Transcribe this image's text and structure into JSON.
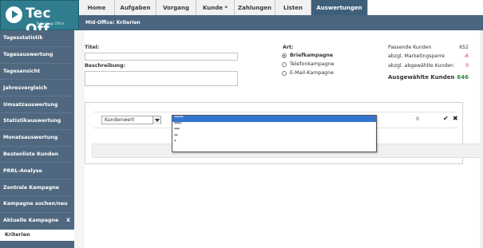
{
  "brand": {
    "name": "Tec Off",
    "tagline": "Technology Office"
  },
  "nav": {
    "tabs": [
      "Home",
      "Aufgaben",
      "Vorgang",
      "Kunde *",
      "Zahlungen",
      "Listen",
      "Auswertungen"
    ],
    "active": "Auswertungen"
  },
  "breadcrumb": "Mid-Office: Kriterien",
  "sidebar": {
    "items": [
      "Tagesstatistik",
      "Tagesauswertung",
      "Tagesansicht",
      "Jahresvergleich",
      "Umsatzauswertung",
      "Statistikauswertung",
      "Monatsauswertung",
      "Bestenliste Kunden",
      "PRRL-Analyse",
      "Zentrale Kampagne",
      "Kampagne suchen/neu"
    ],
    "current": {
      "label": "Aktuelle Kampagne",
      "close": "X"
    },
    "sub": "Kriterien"
  },
  "form": {
    "title_label": "Titel:",
    "title_value": "",
    "description_label": "Beschreibung:",
    "description_value": ""
  },
  "art": {
    "label": "Art:",
    "options": [
      "Briefkampagne",
      "Telefonkampagne",
      "E-Mail-Kampagne"
    ],
    "selected": "Briefkampagne"
  },
  "stats": {
    "rows": [
      {
        "label": "Passende Kunden",
        "value": "652"
      },
      {
        "label": "abzgl. Marketingsperre",
        "value": "-6"
      },
      {
        "label": "abzgl. abgewählte Kunden",
        "value": "0"
      },
      {
        "label": "Ausgewählte Kunden",
        "value": "646"
      }
    ],
    "colors": {
      "negative": "#c0392b",
      "total": "#2e8b3a"
    }
  },
  "criteria": {
    "field": "Kundenwert",
    "count": "0",
    "confirm_icon": "check-icon",
    "remove_icon": "x-icon"
  },
  "dropdown": {
    "options": [
      "*****",
      "****",
      "***",
      "**",
      "*"
    ],
    "highlighted": "*****"
  },
  "colors": {
    "accent": "#3f5f78",
    "sidebar": "#50687f",
    "brand": "#2f7d8e",
    "highlight": "#3275d1"
  }
}
